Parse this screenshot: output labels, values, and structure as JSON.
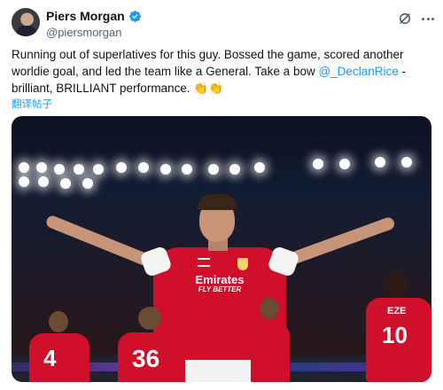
{
  "author": {
    "display_name": "Piers Morgan",
    "handle": "@piersmorgan"
  },
  "tweet": {
    "text_before_mention": "Running out of superlatives for this guy. Bossed the game, scored another worldie goal, and led the team like a General. Take a bow ",
    "mention": "@_DeclanRice",
    "text_after_mention": " - brilliant, BRILLIANT performance. ",
    "emoji": "👏👏"
  },
  "translate_label": "翻译帖子",
  "media": {
    "shirt_sponsor": "Emirates",
    "shirt_sponsor_tagline": "FLY BETTER",
    "teammate_numbers": [
      "4",
      "36",
      "10"
    ],
    "teammate_name": "EZE"
  },
  "colors": {
    "verified": "#1d9bf0",
    "link": "#1d9bf0",
    "arsenal_red": "#d0102b"
  },
  "icons": [
    "verified-badge-icon",
    "grok-icon",
    "more-options-icon"
  ]
}
